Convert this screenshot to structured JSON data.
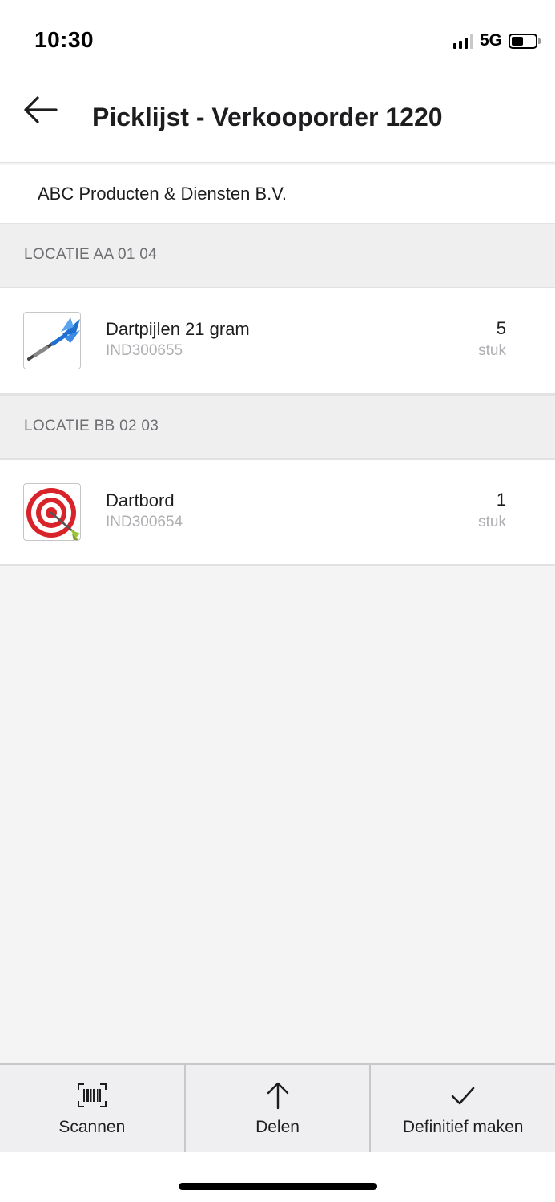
{
  "status_bar": {
    "time": "10:30",
    "network": "5G",
    "battery_level": 0.5
  },
  "header": {
    "title": "Picklijst - Verkooporder 1220",
    "back_icon": "arrow-left-icon"
  },
  "customer": {
    "name": "ABC Producten & Diensten B.V."
  },
  "locations": [
    {
      "label": "LOCATIE AA 01 04",
      "items": [
        {
          "name": "Dartpijlen 21 gram",
          "code": "IND300655",
          "quantity": "5",
          "unit": "stuk",
          "image": "darts-icon"
        }
      ]
    },
    {
      "label": "LOCATIE BB 02 03",
      "items": [
        {
          "name": "Dartbord",
          "code": "IND300654",
          "quantity": "1",
          "unit": "stuk",
          "image": "dartboard-icon"
        }
      ]
    }
  ],
  "toolbar": {
    "scan_label": "Scannen",
    "share_label": "Delen",
    "finalize_label": "Definitief maken"
  },
  "colors": {
    "background": "#f4f4f5",
    "section_header": "#efeff0",
    "text_primary": "#1d1d1f",
    "text_secondary": "#aeaeb2",
    "dart_blue": "#1f6fd1",
    "dartboard_red": "#d8232a"
  }
}
